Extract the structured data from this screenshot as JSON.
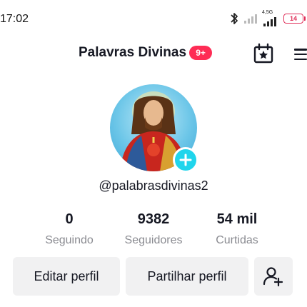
{
  "status_bar": {
    "time": "17:02",
    "network_label": "4,5G",
    "battery": "14"
  },
  "header": {
    "title": "Palavras Divinas",
    "notification_badge": "9+",
    "badge_color": "#fe2c55"
  },
  "profile": {
    "handle": "@palabrasdivinas2",
    "add_button_color": "#20d5ec"
  },
  "stats": [
    {
      "value": "0",
      "label": "Seguindo"
    },
    {
      "value": "9382",
      "label": "Seguidores"
    },
    {
      "value": "54 mil",
      "label": "Curtidas"
    }
  ],
  "actions": {
    "edit_label": "Editar perfil",
    "share_label": "Partilhar perfil"
  },
  "icons": {
    "bluetooth": "bluetooth-icon",
    "calendar": "calendar-star-icon",
    "menu": "hamburger-menu-icon",
    "add": "plus-icon",
    "add_friend": "add-user-icon"
  }
}
